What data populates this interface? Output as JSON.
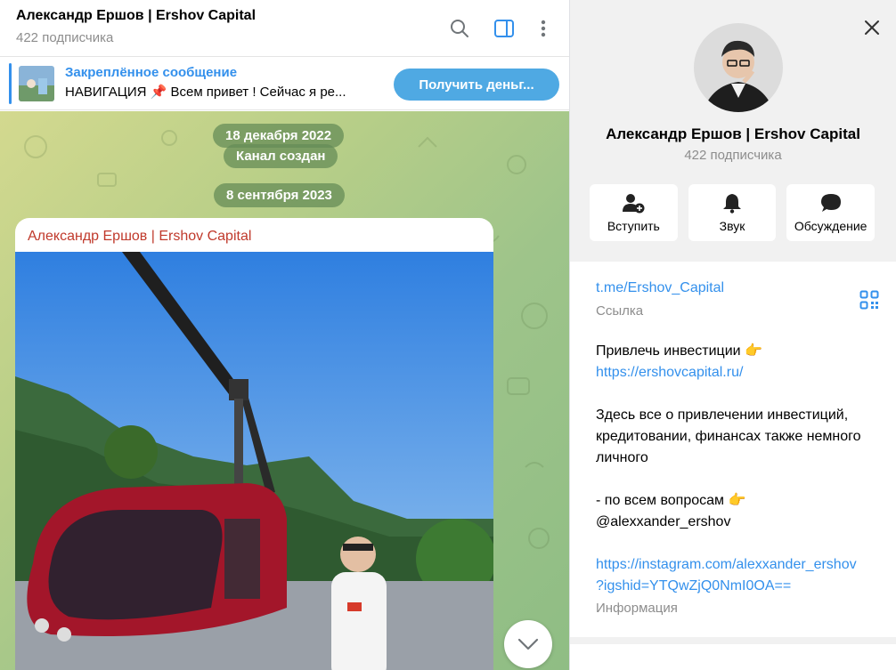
{
  "header": {
    "title": "Александр Ершов | Ershov Capital",
    "subtitle": "422 подписчика",
    "icons": [
      "search-icon",
      "sidebar-toggle-icon",
      "more-vertical-icon"
    ]
  },
  "pinned": {
    "title": "Закреплённое сообщение",
    "text": "НАВИГАЦИЯ 📌  Всем привет ! Сейчас я ре...",
    "button": "Получить деньг..."
  },
  "chat": {
    "dates": [
      {
        "label": "18 декабря 2022"
      },
      {
        "label": "Канал создан"
      },
      {
        "label": "8 сентября 2023"
      }
    ],
    "post": {
      "author": "Александр Ершов | Ershov Capital"
    }
  },
  "profile": {
    "name": "Александр Ершов | Ershov Capital",
    "subscribers": "422 подписчика",
    "actions": [
      {
        "label": "Вступить",
        "icon": "add-user-icon"
      },
      {
        "label": "Звук",
        "icon": "bell-icon"
      },
      {
        "label": "Обсуждение",
        "icon": "chat-bubble-icon"
      }
    ],
    "link": "t.me/Ershov_Capital",
    "link_caption": "Ссылка",
    "description": {
      "line1": "Привлечь инвестиции 👉",
      "line2": "https://ershovcapital.ru/",
      "line3": "Здесь все о привлечении инвестиций,",
      "line4": "кредитовании, финансах также немного",
      "line5": "личного",
      "line6": "- по всем вопросам 👉",
      "line7": "@alexxander_ershov",
      "line8": "https://instagram.com/alexxander_ershov",
      "line9": "?igshid=YTQwZjQ0NmI0OA=="
    },
    "info_caption": "Информация"
  },
  "colors": {
    "accent": "#3390ec",
    "button": "#4fa9e3",
    "author": "#c0392b",
    "date_pill": "#658c57"
  }
}
